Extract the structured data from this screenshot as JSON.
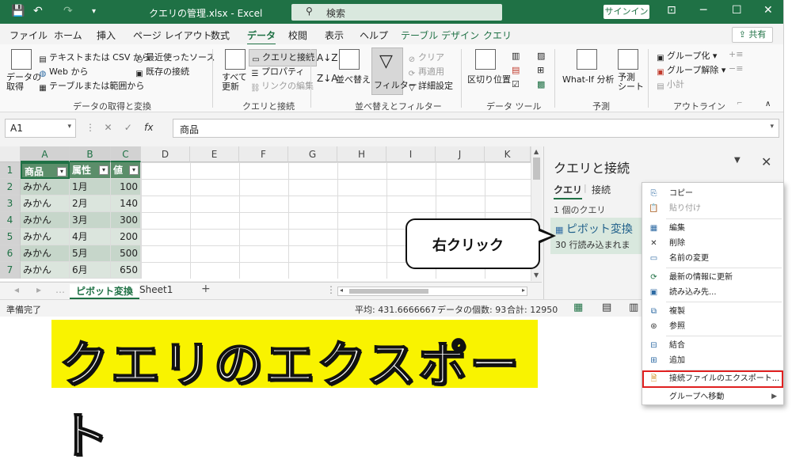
{
  "titlebar": {
    "title": "クエリの管理.xlsx  -  Excel",
    "search_placeholder": "検索",
    "signin": "サインイン",
    "accent": "#1f7145"
  },
  "tabs": [
    "ファイル",
    "ホーム",
    "挿入",
    "ページ レイアウト",
    "数式",
    "データ",
    "校閲",
    "表示",
    "ヘルプ",
    "テーブル デザイン",
    "クエリ"
  ],
  "share": "共有",
  "ribbon": {
    "get_data": "データの\n取得",
    "text_csv": "テキストまたは CSV から",
    "web": "Web から",
    "table_range": "テーブルまたは範囲から",
    "recent_sources": "最近使ったソース",
    "existing_conn": "既存の接続",
    "group1": "データの取得と変換",
    "refresh_all": "すべて\n更新",
    "queries_conn": "クエリと接続",
    "properties": "プロパティ",
    "edit_links": "リンクの編集",
    "group2": "クエリと接続",
    "sort": "並べ替え",
    "filter": "フィルター",
    "clear": "クリア",
    "reapply": "再適用",
    "advanced": "詳細設定",
    "group3": "並べ替えとフィルター",
    "text_to_cols": "区切り位置",
    "group4": "データ ツール",
    "whatif": "What-If 分析",
    "forecast": "予測\nシート",
    "group5": "予測",
    "group_btn": "グループ化",
    "ungroup": "グループ解除",
    "subtotal": "小計",
    "group6": "アウトライン"
  },
  "formula_bar": {
    "name_box": "A1",
    "fx": "fx",
    "value": "商品"
  },
  "grid": {
    "columns": [
      "A",
      "B",
      "C",
      "D",
      "E",
      "F",
      "G",
      "H",
      "I",
      "J",
      "K"
    ],
    "rows": [
      "1",
      "2",
      "3",
      "4",
      "5",
      "6",
      "7"
    ],
    "headers": [
      "商品",
      "属性",
      "値"
    ],
    "data": [
      [
        "みかん",
        "1月",
        "100"
      ],
      [
        "みかん",
        "2月",
        "140"
      ],
      [
        "みかん",
        "3月",
        "300"
      ],
      [
        "みかん",
        "4月",
        "200"
      ],
      [
        "みかん",
        "5月",
        "500"
      ],
      [
        "みかん",
        "6月",
        "650"
      ]
    ]
  },
  "sheet_tabs": {
    "active": "ピボット変換",
    "other": "Sheet1",
    "add": "+"
  },
  "status": {
    "ready": "準備完了",
    "average": "平均: 431.6666667",
    "count": "データの個数: 93",
    "sum": "合計: 12950"
  },
  "pane": {
    "title": "クエリと接続",
    "tab_queries": "クエリ",
    "tab_connections": "接続",
    "count": "1 個のクエリ",
    "query_name": "ピボット変換",
    "query_sub": "30 行読み込まれま"
  },
  "context_menu": {
    "copy": "コピー",
    "paste": "貼り付け",
    "edit": "編集",
    "delete": "削除",
    "rename": "名前の変更",
    "refresh": "最新の情報に更新",
    "load_to": "読み込み先...",
    "duplicate": "複製",
    "reference": "参照",
    "merge": "結合",
    "append": "追加",
    "export": "接続ファイルのエクスポート...",
    "move_group": "グループへ移動"
  },
  "callout": "右クリック",
  "banner": "クエリのエクスポート"
}
